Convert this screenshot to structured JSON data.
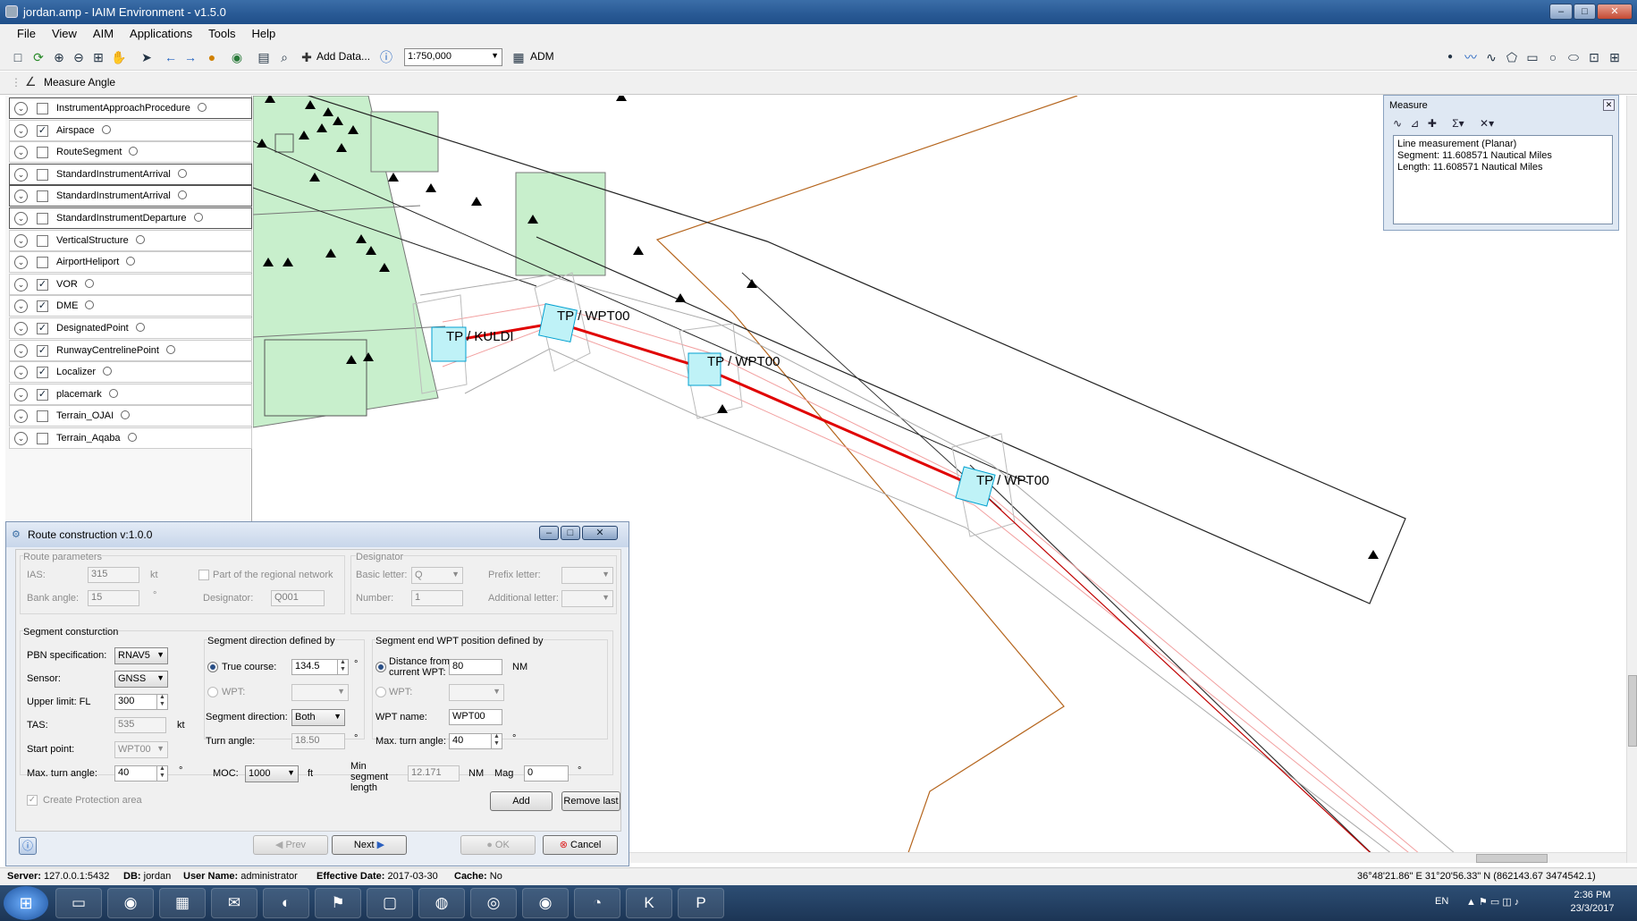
{
  "window": {
    "title": "jordan.amp - IAIM Environment - v1.5.0",
    "min": "–",
    "max": "□",
    "close": "✕"
  },
  "menu": [
    "File",
    "View",
    "AIM",
    "Applications",
    "Tools",
    "Help"
  ],
  "toolbar": {
    "add_data": "Add Data...",
    "scale": "1:750,000",
    "adm": "ADM"
  },
  "toolbar2": {
    "measure_angle": "Measure Angle"
  },
  "layers": [
    {
      "name": "InstrumentApproachProcedure",
      "checked": false,
      "boxed": true
    },
    {
      "name": "Airspace",
      "checked": true,
      "boxed": false
    },
    {
      "name": "RouteSegment",
      "checked": false,
      "boxed": false
    },
    {
      "name": "StandardInstrumentArrival",
      "checked": false,
      "boxed": true
    },
    {
      "name": "StandardInstrumentArrival",
      "checked": false,
      "boxed": true
    },
    {
      "name": "StandardInstrumentDeparture",
      "checked": false,
      "boxed": true
    },
    {
      "name": "VerticalStructure",
      "checked": false,
      "boxed": false
    },
    {
      "name": "AirportHeliport",
      "checked": false,
      "boxed": false
    },
    {
      "name": "VOR",
      "checked": true,
      "boxed": false
    },
    {
      "name": "DME",
      "checked": true,
      "boxed": false
    },
    {
      "name": "DesignatedPoint",
      "checked": true,
      "boxed": false
    },
    {
      "name": "RunwayCentrelinePoint",
      "checked": true,
      "boxed": false
    },
    {
      "name": "Localizer",
      "checked": true,
      "boxed": false
    },
    {
      "name": "placemark",
      "checked": true,
      "boxed": false
    },
    {
      "name": "Terrain_OJAI",
      "checked": false,
      "boxed": false
    },
    {
      "name": "Terrain_Aqaba",
      "checked": false,
      "boxed": false
    }
  ],
  "map": {
    "labels": [
      "TP / KULDI",
      "TP / WPT00",
      "TP / WPT00",
      "TP / WPT00"
    ]
  },
  "measure": {
    "title": "Measure",
    "lines": [
      "Line measurement (Planar)",
      "Segment: 11.608571 Nautical Miles",
      "Length: 11.608571 Nautical Miles"
    ]
  },
  "route": {
    "title": "Route construction v:1.0.0",
    "params": {
      "legend": "Route parameters",
      "ias_label": "IAS:",
      "ias": "315",
      "ias_unit": "kt",
      "bank_label": "Bank angle:",
      "bank": "15",
      "bank_unit": "°",
      "regional": "Part of the regional network",
      "designator_label": "Designator:",
      "designator": "Q001"
    },
    "designator": {
      "legend": "Designator",
      "basic_label": "Basic letter:",
      "basic": "Q",
      "number_label": "Number:",
      "number": "1",
      "prefix_label": "Prefix letter:",
      "additional_label": "Additional letter:"
    },
    "segment": {
      "legend": "Segment consturction",
      "pbn_label": "PBN specification:",
      "pbn": "RNAV5",
      "sensor_label": "Sensor:",
      "sensor": "GNSS",
      "upper_label": "Upper limit: FL",
      "upper": "300",
      "tas_label": "TAS:",
      "tas": "535",
      "tas_unit": "kt",
      "start_label": "Start point:",
      "start": "WPT00",
      "maxturn_label": "Max. turn angle:",
      "maxturn": "40",
      "deg": "°"
    },
    "direction": {
      "legend": "Segment direction defined by",
      "true_course_label": "True course:",
      "true_course": "134.5",
      "wpt_label": "WPT:",
      "segdir_label": "Segment direction:",
      "segdir": "Both",
      "turn_label": "Turn angle:",
      "turn": "18.50",
      "deg": "°"
    },
    "end": {
      "legend": "Segment end WPT position defined by",
      "dist_label": "Distance from current WPT:",
      "dist": "80",
      "dist_unit": "NM",
      "wpt_label": "WPT:",
      "wptname_label": "WPT name:",
      "wptname": "WPT00",
      "maxturn_label": "Max. turn angle:",
      "maxturn": "40",
      "deg": "°"
    },
    "moc_label": "MOC:",
    "moc": "1000",
    "moc_unit": "ft",
    "minseg_label": "Min segment length",
    "minseg": "12.171",
    "minseg_unit": "NM",
    "mag_label": "Mag",
    "mag": "0",
    "mag_unit": "°",
    "create_protection": "Create Protection area",
    "add": "Add",
    "remove_last": "Remove last",
    "prev": "Prev",
    "next": "Next",
    "ok": "OK",
    "cancel": "Cancel"
  },
  "status": {
    "server_label": "Server:",
    "server": "127.0.0.1:5432",
    "db_label": "DB:",
    "db": "jordan",
    "user_label": "User Name:",
    "user": "administrator",
    "eff_label": "Effective Date:",
    "eff": "2017-03-30",
    "cache_label": "Cache:",
    "cache": "No",
    "coords": "36°48'21.86\" E  31°20'56.33\" N  (862143.67  3474542.1)"
  },
  "taskbar": {
    "lang": "EN",
    "time": "2:36 PM",
    "date": "23/3/2017"
  },
  "colors": {
    "route_line": "#ff0000",
    "airspace_fill": "#c8efcc",
    "terrain_line": "#b5651d",
    "title_blue": "#2a5b96"
  }
}
